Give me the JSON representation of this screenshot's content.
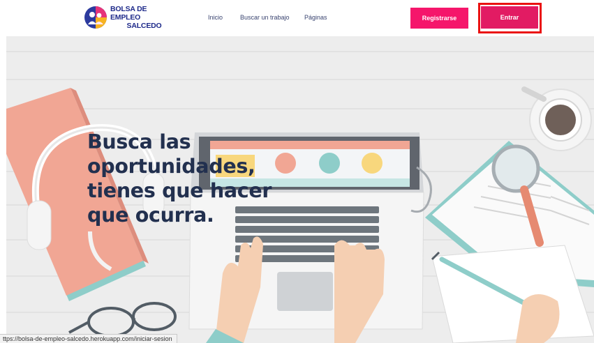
{
  "brand": {
    "name_line1": "BOLSA DE EMPLEO",
    "name_line2": "SALCEDO"
  },
  "nav": {
    "items": [
      "Inicio",
      "Buscar un trabajo",
      "Páginas"
    ]
  },
  "actions": {
    "register_label": "Registrarse",
    "login_label": "Entrar"
  },
  "hero": {
    "headline_lines": [
      "Busca las",
      "oportunidades,",
      "tienes que hacer",
      "que ocurra."
    ]
  },
  "status_bar": {
    "url": "ttps://bolsa-de-empleo-salcedo.herokuapp.com/iniciar-sesion"
  },
  "colors": {
    "brand_pink": "#f5166b",
    "login_pink": "#e21b63",
    "headline_navy": "#22304f",
    "highlight_red": "#ea1111"
  }
}
